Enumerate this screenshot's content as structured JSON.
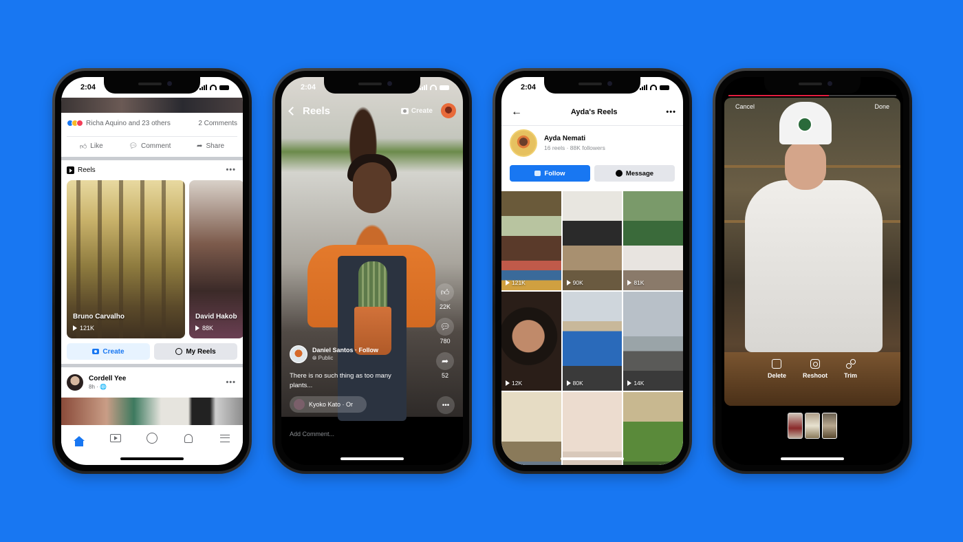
{
  "background_color": "#1877F2",
  "phones": [
    {
      "id": "news-feed",
      "status_time": "2:04",
      "reactions_text": "Richa Aquino and 23 others",
      "comments_count": "2 Comments",
      "actions": [
        "Like",
        "Comment",
        "Share"
      ],
      "reels_section_title": "Reels",
      "reels": [
        {
          "name": "Bruno Carvalho",
          "views": "121K",
          "verified": true
        },
        {
          "name": "David Hakob",
          "views": "88K"
        }
      ],
      "create_label": "Create",
      "my_reels_label": "My Reels",
      "post": {
        "author": "Cordell Yee",
        "meta": "8h · 🌐"
      },
      "nav": [
        "home-icon",
        "watch-icon",
        "groups-icon",
        "notifications-icon",
        "menu-icon"
      ],
      "active_nav": "home"
    },
    {
      "id": "reels-viewer",
      "status_time": "2:04",
      "title": "Reels",
      "create_label": "Create",
      "likes": "22K",
      "comments": "780",
      "shares": "52",
      "author": "Daniel Santos",
      "follow_label": "Follow",
      "author_separator": "·",
      "privacy": "Public",
      "caption": "There is no such thing as too many plants...",
      "audio": "Kyoko Kato · Or",
      "comment_placeholder": "Add Comment..."
    },
    {
      "id": "profile-reels",
      "status_time": "2:04",
      "title": "Ayda's Reels",
      "profile_name": "Ayda Nemati",
      "profile_meta": "16 reels · 88K followers",
      "follow_label": "Follow",
      "message_label": "Message",
      "tiles": [
        {
          "views": "121K",
          "scene": "room"
        },
        {
          "views": "90K",
          "scene": "desk"
        },
        {
          "views": "81K",
          "scene": "yoga"
        },
        {
          "views": "12K",
          "scene": "face"
        },
        {
          "views": "80K",
          "scene": "car"
        },
        {
          "views": "14K",
          "scene": "surf"
        },
        {
          "views": "",
          "scene": "street"
        },
        {
          "views": "",
          "scene": "family"
        },
        {
          "views": "",
          "scene": "plants"
        }
      ]
    },
    {
      "id": "reels-editor",
      "cancel_label": "Cancel",
      "done_label": "Done",
      "recording_progress": 0.6,
      "tools": [
        {
          "label": "Delete",
          "icon": "trash-icon"
        },
        {
          "label": "Reshoot",
          "icon": "camera-icon"
        },
        {
          "label": "Trim",
          "icon": "scissors-icon"
        }
      ],
      "clips_count": 3
    }
  ]
}
